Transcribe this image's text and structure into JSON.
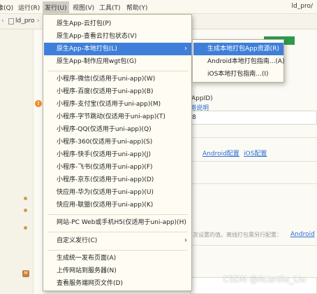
{
  "menubar": {
    "items": [
      {
        "label": "像(Q)"
      },
      {
        "label": "运行(R)"
      },
      {
        "label": "发行(U)"
      },
      {
        "label": "视图(V)"
      },
      {
        "label": "工具(T)"
      },
      {
        "label": "帮助(Y)"
      }
    ],
    "window_title": "ld_pro/"
  },
  "tabbar": {
    "project": "ld_pro"
  },
  "background": {
    "appid_label": "AppID)",
    "appid_link": "用说明",
    "appid_value": "8",
    "android_link": "Android配置",
    "ios_link": "iOS配置",
    "note_text": "次设置的值。离线打包需另行配置：",
    "note_link": "Android"
  },
  "menu": {
    "items": [
      {
        "label": "原生App-云打包(P)"
      },
      {
        "label": "原生App-查看云打包状态(V)"
      },
      {
        "label": "原生App-本地打包(L)"
      },
      {
        "label": "原生App-制作应用wgt包(G)"
      },
      {
        "label": "小程序-微信(仅适用于uni-app)(W)"
      },
      {
        "label": "小程序-百度(仅适用于uni-app)(B)"
      },
      {
        "label": "小程序-支付宝(仅适用于uni-app)(M)"
      },
      {
        "label": "小程序-字节跳动(仅适用于uni-app)(T)"
      },
      {
        "label": "小程序-QQ(仅适用于uni-app)(Q)"
      },
      {
        "label": "小程序-360(仅适用于uni-app)(S)"
      },
      {
        "label": "小程序-快手(仅适用于uni-app)(J)"
      },
      {
        "label": "小程序-飞书(仅适用于uni-app)(F)"
      },
      {
        "label": "小程序-京东(仅适用于uni-app)(D)"
      },
      {
        "label": "快应用-华为(仅适用于uni-app)(U)"
      },
      {
        "label": "快应用-联盟(仅适用于uni-app)(K)"
      },
      {
        "label": "网站-PC Web或手机H5(仅适用于uni-app)(H)"
      },
      {
        "label": "自定义发行(C)"
      },
      {
        "label": "生成统一发布页面(A)"
      },
      {
        "label": "上传网站到服务器(N)"
      },
      {
        "label": "查看服务端网页文件(D)"
      }
    ]
  },
  "submenu": {
    "items": [
      {
        "label": "生成本地打包App资源(R)"
      },
      {
        "label": "Android本地打包指南...(A)"
      },
      {
        "label": "iOS本地打包指南...(I)"
      }
    ]
  },
  "watermark": "CSDN @Acardia_Liu",
  "colors": {
    "highlight": "#3f7fd9",
    "menu_bg": "#fffdf3",
    "accent_green": "#2f9a4a",
    "link": "#2a6fd6"
  }
}
